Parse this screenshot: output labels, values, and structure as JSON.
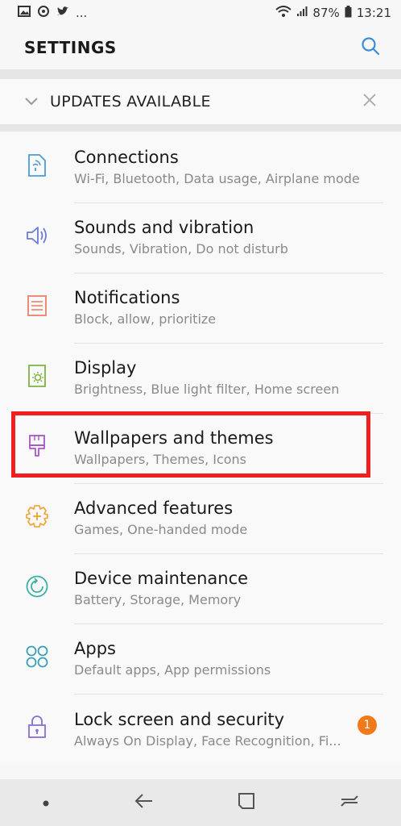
{
  "status_bar": {
    "battery": "87%",
    "time": "13:21",
    "more": "..."
  },
  "header": {
    "title": "SETTINGS"
  },
  "updates": {
    "label": "UPDATES AVAILABLE"
  },
  "items": [
    {
      "title": "Connections",
      "subtitle": "Wi-Fi, Bluetooth, Data usage, Airplane mode",
      "icon": "connections-icon",
      "color": "#4a9cd8"
    },
    {
      "title": "Sounds and vibration",
      "subtitle": "Sounds, Vibration, Do not disturb",
      "icon": "speaker-icon",
      "color": "#6b7bd6"
    },
    {
      "title": "Notifications",
      "subtitle": "Block, allow, prioritize",
      "icon": "notifications-icon",
      "color": "#e8836a"
    },
    {
      "title": "Display",
      "subtitle": "Brightness, Blue light filter, Home screen",
      "icon": "display-icon",
      "color": "#7cb342"
    },
    {
      "title": "Wallpapers and themes",
      "subtitle": "Wallpapers, Themes, Icons",
      "icon": "paintbrush-icon",
      "color": "#a855c8"
    },
    {
      "title": "Advanced features",
      "subtitle": "Games, One-handed mode",
      "icon": "gear-plus-icon",
      "color": "#f0a030"
    },
    {
      "title": "Device maintenance",
      "subtitle": "Battery, Storage, Memory",
      "icon": "maintenance-icon",
      "color": "#3ab0a0"
    },
    {
      "title": "Apps",
      "subtitle": "Default apps, App permissions",
      "icon": "apps-icon",
      "color": "#3aa0b8"
    },
    {
      "title": "Lock screen and security",
      "subtitle": "Always On Display, Face Recognition, Fi...",
      "icon": "lock-icon",
      "color": "#8a6fd0"
    }
  ],
  "lock_badge": "1",
  "highlight_color": "#f01e1e"
}
